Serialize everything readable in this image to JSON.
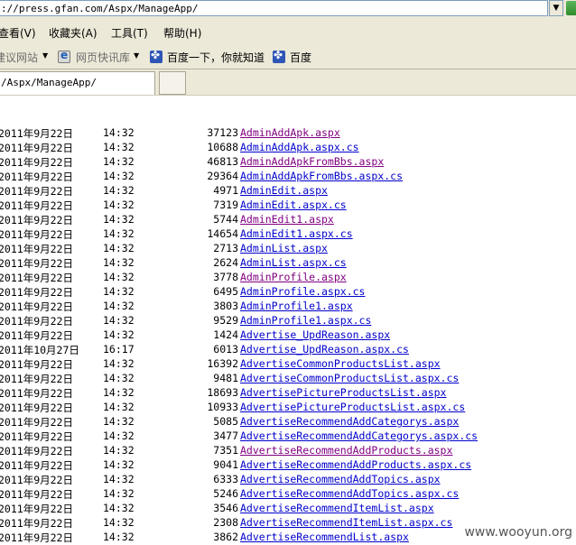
{
  "address_bar": {
    "url": "://press.gfan.com/Aspx/ManageApp/"
  },
  "menu": {
    "items": [
      "查看(V)",
      "收藏夹(A)",
      "工具(T)",
      "帮助(H)"
    ]
  },
  "links_bar": {
    "items": [
      {
        "label": "建议网站",
        "icon": "",
        "dropdown": true
      },
      {
        "label": "网页快讯库",
        "icon": "ie-icon",
        "dropdown": true
      },
      {
        "label": "百度一下，你就知道",
        "icon": "paw-icon",
        "dropdown": false
      },
      {
        "label": "百度",
        "icon": "paw-icon",
        "dropdown": false
      }
    ]
  },
  "tab": {
    "title": "/Aspx/ManageApp/"
  },
  "listing": {
    "rows": [
      {
        "date": "2011年9月22日",
        "time": "14:32",
        "size": "37123",
        "name": "AdminAddApk.aspx",
        "visited": true
      },
      {
        "date": "2011年9月22日",
        "time": "14:32",
        "size": "10688",
        "name": "AdminAddApk.aspx.cs",
        "visited": false
      },
      {
        "date": "2011年9月22日",
        "time": "14:32",
        "size": "46813",
        "name": "AdminAddApkFromBbs.aspx",
        "visited": true
      },
      {
        "date": "2011年9月22日",
        "time": "14:32",
        "size": "29364",
        "name": "AdminAddApkFromBbs.aspx.cs",
        "visited": false
      },
      {
        "date": "2011年9月22日",
        "time": "14:32",
        "size": "4971",
        "name": "AdminEdit.aspx",
        "visited": false
      },
      {
        "date": "2011年9月22日",
        "time": "14:32",
        "size": "7319",
        "name": "AdminEdit.aspx.cs",
        "visited": false
      },
      {
        "date": "2011年9月22日",
        "time": "14:32",
        "size": "5744",
        "name": "AdminEdit1.aspx",
        "visited": true
      },
      {
        "date": "2011年9月22日",
        "time": "14:32",
        "size": "14654",
        "name": "AdminEdit1.aspx.cs",
        "visited": false
      },
      {
        "date": "2011年9月22日",
        "time": "14:32",
        "size": "2713",
        "name": "AdminList.aspx",
        "visited": false
      },
      {
        "date": "2011年9月22日",
        "time": "14:32",
        "size": "2624",
        "name": "AdminList.aspx.cs",
        "visited": false
      },
      {
        "date": "2011年9月22日",
        "time": "14:32",
        "size": "3778",
        "name": "AdminProfile.aspx",
        "visited": true
      },
      {
        "date": "2011年9月22日",
        "time": "14:32",
        "size": "6495",
        "name": "AdminProfile.aspx.cs",
        "visited": false
      },
      {
        "date": "2011年9月22日",
        "time": "14:32",
        "size": "3803",
        "name": "AdminProfile1.aspx",
        "visited": false
      },
      {
        "date": "2011年9月22日",
        "time": "14:32",
        "size": "9529",
        "name": "AdminProfile1.aspx.cs",
        "visited": false
      },
      {
        "date": "2011年9月22日",
        "time": "14:32",
        "size": "1424",
        "name": "Advertise_UpdReason.aspx",
        "visited": false
      },
      {
        "date": "2011年10月27日",
        "time": "16:17",
        "size": "6013",
        "name": "Advertise_UpdReason.aspx.cs",
        "visited": false
      },
      {
        "date": "2011年9月22日",
        "time": "14:32",
        "size": "16392",
        "name": "AdvertiseCommonProductsList.aspx",
        "visited": false
      },
      {
        "date": "2011年9月22日",
        "time": "14:32",
        "size": "9481",
        "name": "AdvertiseCommonProductsList.aspx.cs",
        "visited": false
      },
      {
        "date": "2011年9月22日",
        "time": "14:32",
        "size": "18693",
        "name": "AdvertisePictureProductsList.aspx",
        "visited": false
      },
      {
        "date": "2011年9月22日",
        "time": "14:32",
        "size": "10933",
        "name": "AdvertisePictureProductsList.aspx.cs",
        "visited": false
      },
      {
        "date": "2011年9月22日",
        "time": "14:32",
        "size": "5085",
        "name": "AdvertiseRecommendAddCategorys.aspx",
        "visited": false
      },
      {
        "date": "2011年9月22日",
        "time": "14:32",
        "size": "3477",
        "name": "AdvertiseRecommendAddCategorys.aspx.cs",
        "visited": false
      },
      {
        "date": "2011年9月22日",
        "time": "14:32",
        "size": "7351",
        "name": "AdvertiseRecommendAddProducts.aspx",
        "visited": true
      },
      {
        "date": "2011年9月22日",
        "time": "14:32",
        "size": "9041",
        "name": "AdvertiseRecommendAddProducts.aspx.cs",
        "visited": false
      },
      {
        "date": "2011年9月22日",
        "time": "14:32",
        "size": "6333",
        "name": "AdvertiseRecommendAddTopics.aspx",
        "visited": false
      },
      {
        "date": "2011年9月22日",
        "time": "14:32",
        "size": "5246",
        "name": "AdvertiseRecommendAddTopics.aspx.cs",
        "visited": false
      },
      {
        "date": "2011年9月22日",
        "time": "14:32",
        "size": "3546",
        "name": "AdvertiseRecommendItemList.aspx",
        "visited": false
      },
      {
        "date": "2011年9月22日",
        "time": "14:32",
        "size": "2308",
        "name": "AdvertiseRecommendItemList.aspx.cs",
        "visited": false
      },
      {
        "date": "2011年9月22日",
        "time": "14:32",
        "size": "3862",
        "name": "AdvertiseRecommendList.aspx",
        "visited": false
      }
    ]
  },
  "watermark": "www.wooyun.org"
}
